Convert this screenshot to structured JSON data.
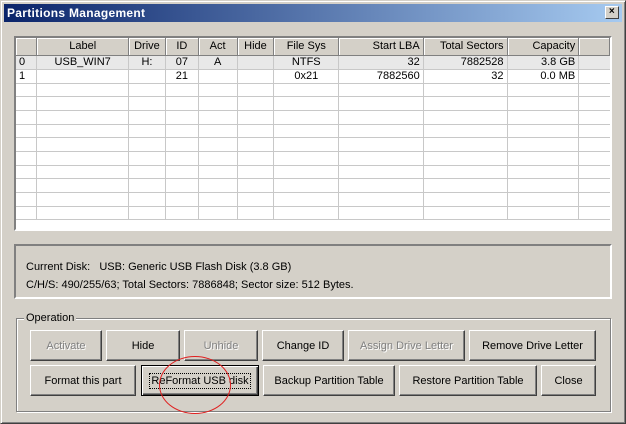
{
  "window": {
    "title": "Partitions Management",
    "close_glyph": "×"
  },
  "table": {
    "columns": [
      "",
      "Label",
      "Drive",
      "ID",
      "Act",
      "Hide",
      "File Sys",
      "Start LBA",
      "Total Sectors",
      "Capacity"
    ],
    "rows": [
      [
        "0",
        "USB_WIN7",
        "H:",
        "07",
        "A",
        "",
        "NTFS",
        "32",
        "7882528",
        "3.8 GB"
      ],
      [
        "1",
        "",
        "",
        "21",
        "",
        "",
        "0x21",
        "7882560",
        "32",
        "0.0 MB"
      ]
    ]
  },
  "disk_info": {
    "line1": "Current Disk:   USB: Generic USB Flash Disk (3.8 GB)",
    "line2": "C/H/S: 490/255/63; Total Sectors: 7886848; Sector size: 512 Bytes."
  },
  "operation": {
    "legend": "Operation",
    "buttons": {
      "activate": "Activate",
      "hide": "Hide",
      "unhide": "Unhide",
      "change_id": "Change ID",
      "assign_letter": "Assign Drive Letter",
      "remove_letter": "Remove Drive Letter",
      "format_part": "Format this part",
      "reformat_usb": "ReFormat USB disk",
      "backup": "Backup Partition Table",
      "restore": "Restore Partition Table",
      "close": "Close"
    }
  },
  "annotation": {
    "color": "#e02020"
  }
}
